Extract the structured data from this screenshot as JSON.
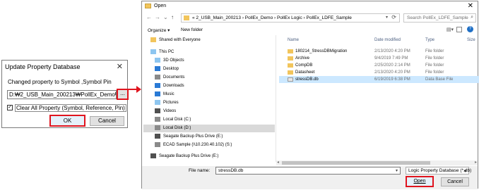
{
  "update_dialog": {
    "title": "Update Property Database",
    "close": "✕",
    "label": "Changed property to Symbol ,Symbol Pin",
    "path_value": "D:₩2_USB_Main_200213₩PollEx_Demo₩",
    "browse_label": "...",
    "clear_all_checked": true,
    "clear_all_label": "Clear All Property (Symbol, Reference, Pin)",
    "ok_label": "OK",
    "cancel_label": "Cancel",
    "highlight_color": "#e0141e"
  },
  "open_dialog": {
    "title": "Open",
    "close": "✕",
    "nav": {
      "back": "←",
      "forward": "→",
      "up_dropdown": "⌄",
      "up": "↑"
    },
    "address_crumbs": "« 2_USB_Main_200213 › PollEx_Demo › PollEx Logic › PollEx_LDFE_Sample",
    "search_placeholder": "Search PollEx_LDFE_Sample",
    "organize_label": "Organize ▾",
    "new_folder_label": "New folder",
    "nav_items": [
      {
        "label": "Shared with Everyone",
        "icon": "folder-icon"
      },
      {
        "label": "This PC",
        "icon": "computer-icon"
      },
      {
        "label": "3D Objects",
        "icon": "cube-icon"
      },
      {
        "label": "Desktop",
        "icon": "desktop-icon"
      },
      {
        "label": "Documents",
        "icon": "documents-icon"
      },
      {
        "label": "Downloads",
        "icon": "download-icon"
      },
      {
        "label": "Music",
        "icon": "music-icon"
      },
      {
        "label": "Pictures",
        "icon": "pictures-icon"
      },
      {
        "label": "Videos",
        "icon": "videos-icon"
      },
      {
        "label": "Local Disk (C:)",
        "icon": "drive-icon"
      },
      {
        "label": "Local Disk (D:)",
        "icon": "drive-icon",
        "selected": true
      },
      {
        "label": "Seagate Backup Plus Drive (E:)",
        "icon": "usb-drive-icon"
      },
      {
        "label": "ECAD Sample (\\\\10.230.40.102) (S:)",
        "icon": "network-drive-icon"
      },
      {
        "label": "Seagate Backup Plus Drive (E:)",
        "icon": "usb-drive-icon"
      }
    ],
    "columns": {
      "name": "Name",
      "date": "Date modified",
      "type": "Type",
      "size": "Size"
    },
    "files": [
      {
        "name": "180214_StressDBMigration",
        "date": "2/13/2020 4:20 PM",
        "type": "File folder",
        "icon": "folder-icon"
      },
      {
        "name": "Archive",
        "date": "9/4/2019 7:49 PM",
        "type": "File folder",
        "icon": "folder-icon"
      },
      {
        "name": "CompDB",
        "date": "2/25/2020 2:14 PM",
        "type": "File folder",
        "icon": "folder-icon"
      },
      {
        "name": "Datasheet",
        "date": "2/13/2020 4:20 PM",
        "type": "File folder",
        "icon": "folder-icon"
      },
      {
        "name": "stressDB.db",
        "date": "6/19/2019 6:38 PM",
        "type": "Data Base File",
        "icon": "db-file-icon",
        "selected": true
      }
    ],
    "file_name_label": "File name:",
    "file_name_value": "stressDB.db",
    "file_type_value": "Logic Property Database (*.db)",
    "open_label": "Open",
    "cancel_label": "Cancel"
  }
}
